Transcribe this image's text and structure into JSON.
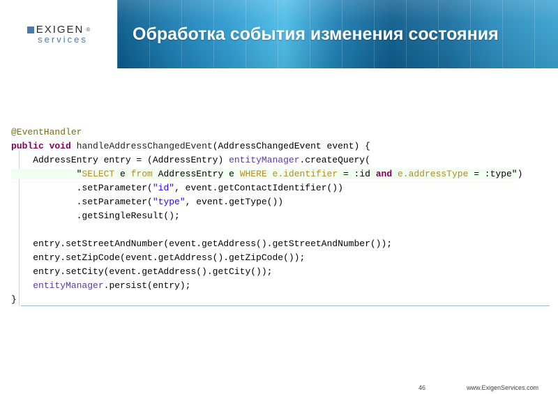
{
  "header": {
    "logo_brand": "EXIGEN",
    "logo_sub": "services",
    "title": "Обработка события изменения состояния"
  },
  "code": {
    "annotation": "@EventHandler",
    "kw_public": "public",
    "kw_void": "void",
    "method_name": "handleAddressChangedEvent",
    "sig_rest": "(AddressChangedEvent event) {",
    "line_entry_a": "    AddressEntry entry = (AddressEntry) ",
    "entityManager": "entityManager",
    "line_entry_b": ".createQuery(",
    "query_open": "            \"",
    "query_select": "SELECT",
    "query_mid1": " e ",
    "query_from": "from",
    "query_mid2": " AddressEntry e ",
    "query_where": "WHERE",
    "query_mid3": " ",
    "query_ident": "e.identifier",
    "query_eqid": " = :id ",
    "query_and": "and",
    "query_mid4": " ",
    "query_addr": "e.addressType",
    "query_eqtype": " = :type\"",
    "query_close": ")",
    "set_param1_a": "            .setParameter(",
    "param_id": "\"id\"",
    "set_param1_b": ", event.getContactIdentifier())",
    "set_param2_a": "            .setParameter(",
    "param_type": "\"type\"",
    "set_param2_b": ", event.getType())",
    "get_single": "            .getSingleResult();",
    "blank": "",
    "set_street": "    entry.setStreetAndNumber(event.getAddress().getStreetAndNumber());",
    "set_zip": "    entry.setZipCode(event.getAddress().getZipCode());",
    "set_city": "    entry.setCity(event.getAddress().getCity());",
    "persist_a": "    ",
    "persist_b": ".persist(entry);",
    "brace": "}"
  },
  "footer": {
    "page": "46",
    "url": "www.ExigenServices.com"
  }
}
